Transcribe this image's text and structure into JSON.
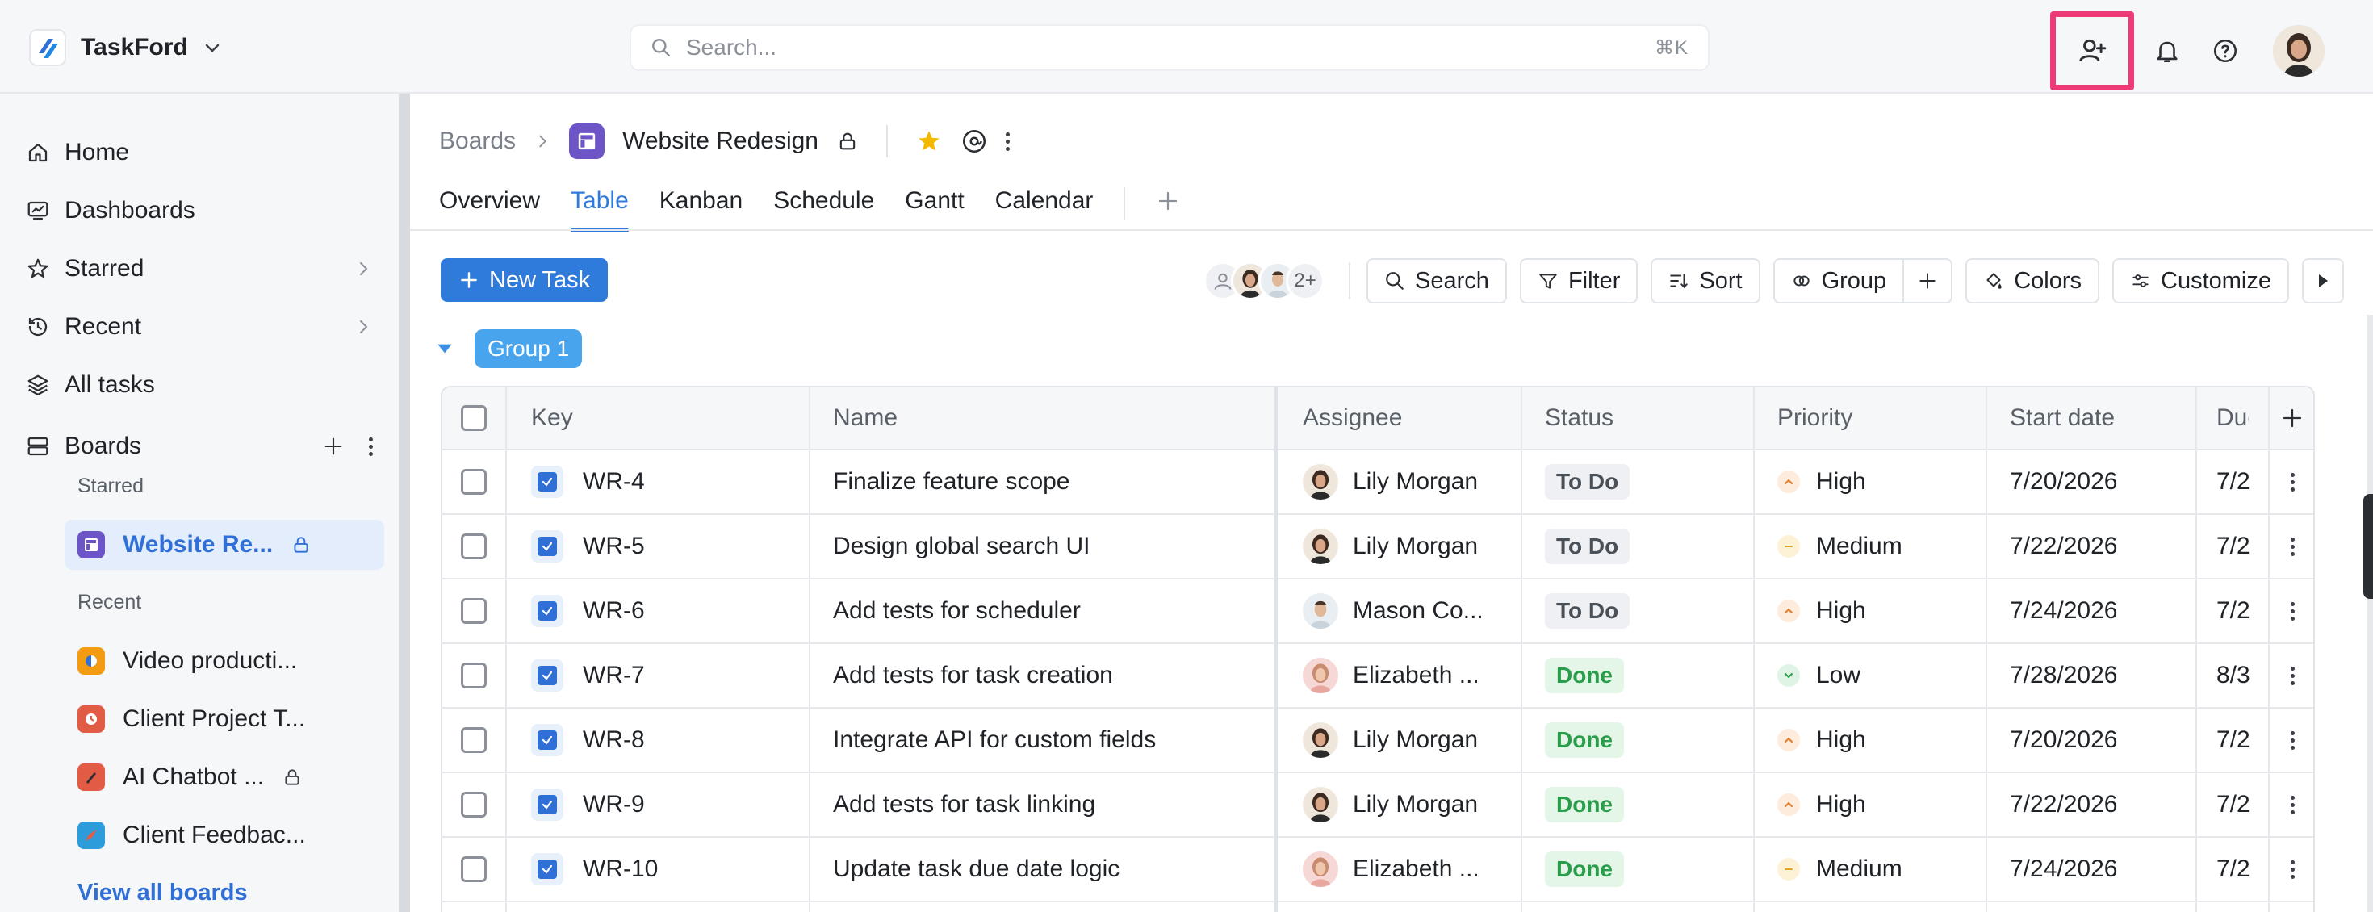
{
  "app": {
    "name": "TaskFord"
  },
  "search": {
    "placeholder": "Search...",
    "shortcut": "⌘K"
  },
  "sidebar": {
    "nav": [
      {
        "label": "Home",
        "icon": "home-icon"
      },
      {
        "label": "Dashboards",
        "icon": "dashboard-icon"
      },
      {
        "label": "Starred",
        "icon": "star-icon"
      },
      {
        "label": "Recent",
        "icon": "history-icon"
      },
      {
        "label": "All tasks",
        "icon": "layers-icon"
      },
      {
        "label": "Boards",
        "icon": "boards-icon"
      }
    ],
    "starred_label": "Starred",
    "recent_label": "Recent",
    "starred_boards": [
      {
        "label": "Website Re...",
        "locked": true
      }
    ],
    "recent_boards": [
      {
        "label": "Video producti...",
        "color": "#f39c12"
      },
      {
        "label": "Client Project T...",
        "color": "#e25b45"
      },
      {
        "label": "AI Chatbot ...",
        "color": "#e25b45",
        "locked": true
      },
      {
        "label": "Client Feedbac...",
        "color": "#2d9cdb"
      }
    ],
    "view_all": "View all boards"
  },
  "breadcrumb": {
    "root": "Boards",
    "board": "Website Redesign"
  },
  "tabs": [
    "Overview",
    "Table",
    "Kanban",
    "Schedule",
    "Gantt",
    "Calendar"
  ],
  "active_tab": "Table",
  "toolbar": {
    "new_task": "New Task",
    "members_more": "2+",
    "search": "Search",
    "filter": "Filter",
    "sort": "Sort",
    "group": "Group",
    "colors": "Colors",
    "customize": "Customize"
  },
  "group": {
    "label": "Group 1"
  },
  "table": {
    "columns": [
      "Key",
      "Name",
      "Assignee",
      "Status",
      "Priority",
      "Start date",
      "Due"
    ],
    "rows": [
      {
        "key": "WR-4",
        "name": "Finalize feature scope",
        "assignee": "Lily Morgan",
        "status": "To Do",
        "priority": "High",
        "start": "7/20/2026",
        "due": "7/2"
      },
      {
        "key": "WR-5",
        "name": "Design global search UI",
        "assignee": "Lily Morgan",
        "status": "To Do",
        "priority": "Medium",
        "start": "7/22/2026",
        "due": "7/2"
      },
      {
        "key": "WR-6",
        "name": "Add tests for scheduler",
        "assignee": "Mason Co...",
        "status": "To Do",
        "priority": "High",
        "start": "7/24/2026",
        "due": "7/2"
      },
      {
        "key": "WR-7",
        "name": "Add tests for task creation",
        "assignee": "Elizabeth ...",
        "status": "Done",
        "priority": "Low",
        "start": "7/28/2026",
        "due": "8/3"
      },
      {
        "key": "WR-8",
        "name": "Integrate API for custom fields",
        "assignee": "Lily Morgan",
        "status": "Done",
        "priority": "High",
        "start": "7/20/2026",
        "due": "7/2"
      },
      {
        "key": "WR-9",
        "name": "Add tests for task linking",
        "assignee": "Lily Morgan",
        "status": "Done",
        "priority": "High",
        "start": "7/22/2026",
        "due": "7/2"
      },
      {
        "key": "WR-10",
        "name": "Update task due date logic",
        "assignee": "Elizabeth ...",
        "status": "Done",
        "priority": "Medium",
        "start": "7/24/2026",
        "due": "7/2"
      }
    ]
  },
  "colors": {
    "accent": "#2f7bdc",
    "highlight": "#ef3a78",
    "done": "#2a9d4b"
  }
}
